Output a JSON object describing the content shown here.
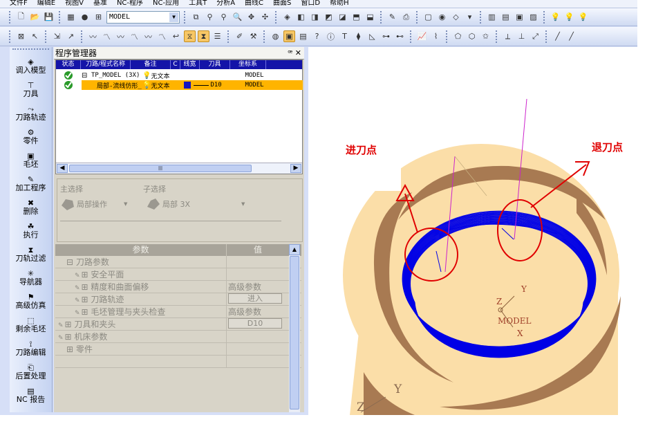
{
  "menu": [
    "文件F",
    "编辑E",
    "视图V",
    "基准",
    "NC-程序",
    "NC-应用",
    "工具T",
    "分析A",
    "曲线C",
    "曲面S",
    "窗口D",
    "帮助H"
  ],
  "toolbar": {
    "model_combo": "MODEL"
  },
  "leftbar": {
    "items": [
      {
        "label": "调入模型",
        "icon": "import-model-icon"
      },
      {
        "label": "刀具",
        "icon": "tool-icon"
      },
      {
        "label": "刀路轨迹",
        "icon": "toolpath-icon"
      },
      {
        "label": "零件",
        "icon": "part-icon"
      },
      {
        "label": "毛坯",
        "icon": "stock-icon"
      },
      {
        "label": "加工程序",
        "icon": "program-icon"
      },
      {
        "label": "删除",
        "icon": "delete-icon"
      },
      {
        "label": "执行",
        "icon": "run-icon"
      },
      {
        "label": "刀轨过滤",
        "icon": "filter-icon"
      },
      {
        "label": "导航器",
        "icon": "navigator-icon"
      },
      {
        "label": "高级仿真",
        "icon": "simulation-icon"
      },
      {
        "label": "剩余毛坯",
        "icon": "rest-stock-icon"
      },
      {
        "label": "刀路编辑",
        "icon": "edit-path-icon"
      },
      {
        "label": "后置处理",
        "icon": "post-icon"
      },
      {
        "label": "NC 报告",
        "icon": "report-icon"
      }
    ]
  },
  "program_manager": {
    "title": "程序管理器",
    "controls": "ꟹ ✕",
    "columns": [
      "状态",
      "刀路/程式名称",
      "备注",
      "C",
      "线宽",
      "刀具",
      "坐标系"
    ],
    "rows": [
      {
        "name": "TP_MODEL (3X)",
        "note": "无文本",
        "tool": "",
        "coord": "MODEL",
        "selected": false,
        "expander": "⊟"
      },
      {
        "name": "局部-流线仿形_",
        "note": "无文本",
        "tool": "D10",
        "coord": "MODEL",
        "selected": true,
        "expander": ""
      }
    ],
    "scroll_thumb": "|||"
  },
  "selection": {
    "main_label": "主选择",
    "sub_label": "子选择",
    "main_value": "局部操作",
    "sub_value": "局部 3X"
  },
  "params": {
    "header_name": "参数",
    "header_value": "值",
    "rows": [
      {
        "name": "⊟ 刀路参数",
        "value": "",
        "button": false,
        "indent": 16
      },
      {
        "name": "⊞ 安全平面",
        "value": "",
        "button": false,
        "indent": 28
      },
      {
        "name": "⊞ 精度和曲面偏移",
        "value": "高级参数",
        "button": false,
        "indent": 28
      },
      {
        "name": "⊞ 刀路轨迹",
        "value": "进入",
        "button": true,
        "indent": 28
      },
      {
        "name": "⊞ 毛坯管理与夹头检查",
        "value": "高级参数",
        "button": false,
        "indent": 28
      },
      {
        "name": "⊞ 刀具和夹头",
        "value": "D10",
        "button": true,
        "indent": 4
      },
      {
        "name": "⊞ 机床参数",
        "value": "",
        "button": false,
        "indent": 4
      },
      {
        "name": "⊞ 零件",
        "value": "",
        "button": false,
        "indent": 16
      },
      {
        "name": "",
        "value": "",
        "button": false,
        "indent": 4
      }
    ]
  },
  "viewport": {
    "callout_enter": "进刀点",
    "callout_exit": "退刀点",
    "axis_y": "Y",
    "axis_z": "Z",
    "axis_x": "X",
    "axis_model": "MODEL",
    "corner_y": "Y",
    "corner_z": "Z",
    "colors": {
      "light": "#fbdea8",
      "brown": "#a87a52",
      "path": "#0000e6",
      "annotation": "#e00000",
      "guide": "#cc22cc"
    }
  }
}
